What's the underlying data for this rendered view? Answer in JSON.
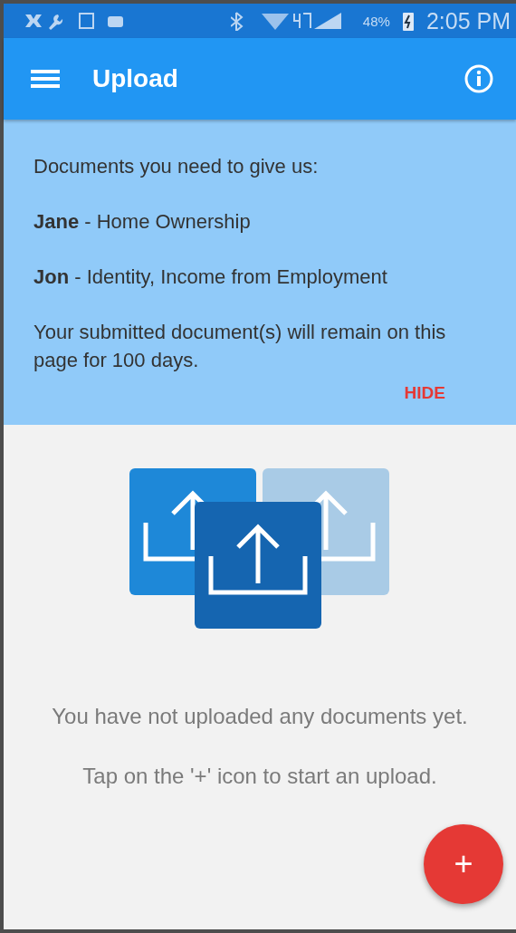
{
  "status_bar": {
    "battery": "48%",
    "time": "2:05 PM"
  },
  "app_bar": {
    "title": "Upload"
  },
  "banner": {
    "heading": "Documents you need to give us:",
    "lines": [
      "**Jane** - Home Ownership",
      "**Jon** - Identity, Income from Employment"
    ],
    "note": "Your submitted document(s) will remain on this page for 100 days.",
    "action": "HIDE"
  },
  "empty_state": {
    "message": "You have not uploaded any documents yet.",
    "hint": "Tap on the '+' icon to start an upload."
  },
  "fab": {
    "label": "+"
  }
}
